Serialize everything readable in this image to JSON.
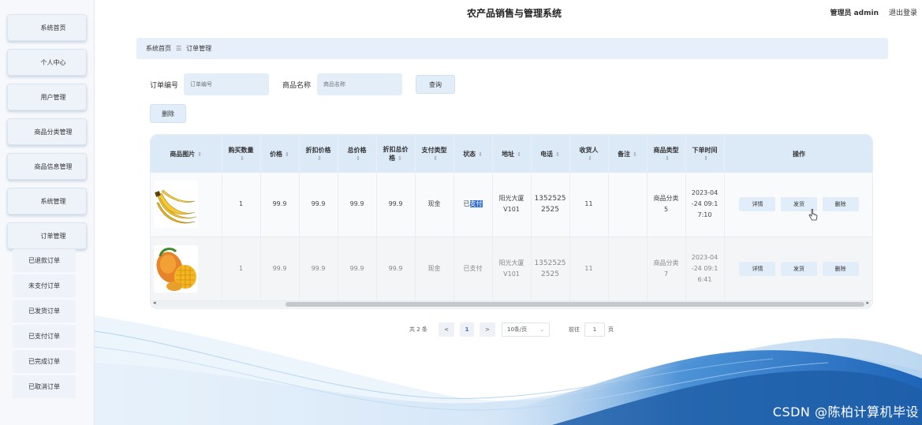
{
  "app": {
    "title": "农产品销售与管理系统",
    "user_label": "管理员 admin",
    "logout_label": "退出登录"
  },
  "sidebar": {
    "items": [
      {
        "label": "系统首页"
      },
      {
        "label": "个人中心"
      },
      {
        "label": "用户管理"
      },
      {
        "label": "商品分类管理"
      },
      {
        "label": "商品信息管理"
      },
      {
        "label": "系统管理"
      },
      {
        "label": "订单管理"
      }
    ],
    "sub_items": [
      {
        "label": "已退款订单"
      },
      {
        "label": "未支付订单"
      },
      {
        "label": "已发货订单"
      },
      {
        "label": "已支付订单"
      },
      {
        "label": "已完成订单"
      },
      {
        "label": "已取消订单"
      }
    ]
  },
  "breadcrumb": {
    "home": "系统首页",
    "separator": "☰",
    "current": "订单管理"
  },
  "search": {
    "order_no_label": "订单编号",
    "order_no_placeholder": "订单编号",
    "order_no_value": "",
    "product_label": "商品名称",
    "product_placeholder": "商品名称",
    "product_value": "",
    "query_button": "查询",
    "delete_button": "删除"
  },
  "table": {
    "headers": [
      "商品图片",
      "购买数量",
      "价格",
      "折扣价格",
      "总价格",
      "折扣总价格",
      "支付类型",
      "状态",
      "地址",
      "电话",
      "收货人",
      "备注",
      "商品类型",
      "下单时间",
      "操作"
    ],
    "header_lines": [
      [
        "商品图片"
      ],
      [
        "购买数量"
      ],
      [
        "价格"
      ],
      [
        "折扣价格"
      ],
      [
        "总价格"
      ],
      [
        "折扣总价",
        "格"
      ],
      [
        "支付类型"
      ],
      [
        "状态"
      ],
      [
        "地址"
      ],
      [
        "电话"
      ],
      [
        "收货人"
      ],
      [
        "备注"
      ],
      [
        "商品类型"
      ],
      [
        "下单时间"
      ],
      [
        "操作"
      ]
    ],
    "rows": [
      {
        "image": "banana-image",
        "quantity": "1",
        "price": "99.9",
        "discount_price": "99.9",
        "total": "99.9",
        "discount_total": "99.9",
        "pay_type": "现金",
        "status_prefix": "已",
        "status_highlight": "支付",
        "address": "阳光大厦V101",
        "address_lines": [
          "阳光大厦",
          "V101"
        ],
        "phone": "13525252525",
        "phone_lines": [
          "1352525",
          "2525"
        ],
        "receiver": "11",
        "note": "",
        "category": "商品分类5",
        "category_lines": [
          "商品分类",
          "5"
        ],
        "time": "2023-04-24 09:17:10",
        "time_lines": [
          "2023-04",
          "-24 09:1",
          "7:10"
        ]
      },
      {
        "image": "mango-image",
        "quantity": "1",
        "price": "99.9",
        "discount_price": "99.9",
        "total": "99.9",
        "discount_total": "99.9",
        "pay_type": "现金",
        "status": "已支付",
        "address": "阳光大厦V101",
        "address_lines": [
          "阳光大厦",
          "V101"
        ],
        "phone": "13525252525",
        "phone_lines": [
          "1352525",
          "2525"
        ],
        "receiver": "11",
        "note": "",
        "category": "商品分类7",
        "category_lines": [
          "商品分类",
          "7"
        ],
        "time": "2023-04-24 09:16:41",
        "time_lines": [
          "2023-04",
          "-24 09:1",
          "6:41"
        ]
      }
    ],
    "actions": {
      "detail": "详情",
      "ship": "发货",
      "delete": "删除"
    }
  },
  "pagination": {
    "total": "共 2 条",
    "prev": "<",
    "current_page": "1",
    "next": ">",
    "page_size": "10条/页",
    "goto_label": "前往",
    "goto_value": "1",
    "goto_suffix": "页"
  },
  "watermark": "CSDN @陈柏计算机毕设",
  "colors": {
    "accent": "#2f6fd1",
    "header_bg": "#dce9f7",
    "button_bg": "#e1edf8",
    "wave": "#4a8fd6"
  }
}
